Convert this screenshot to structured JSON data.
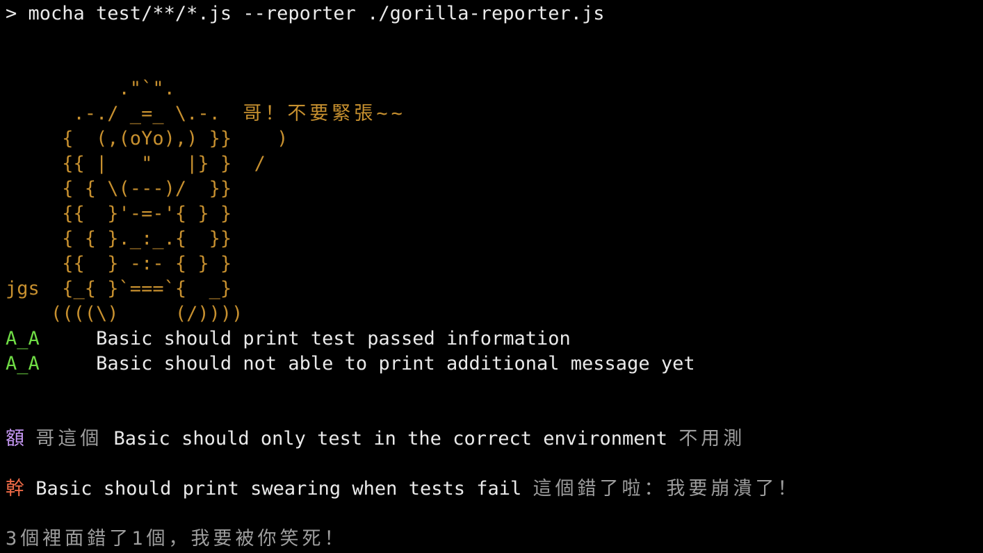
{
  "terminal": {
    "command": "> mocha test/**/*.js --reporter ./gorilla-reporter.js",
    "gorilla_art": [
      "          .\"`\".",
      "      .-./ _=_ \\.-.  ",
      "     {  (,(oYo),) }}    )",
      "     {{ |   \"   |} }  /",
      "     { { \\(---)/  }}",
      "     {{  }'-=-'{ } }",
      "     { { }._:_.{  }}",
      "     {{  } -:- { } }",
      "jgs  {_{ }`===`{  _}",
      "    ((((\\)     (/))))"
    ],
    "gorilla_speech": "哥！不要緊張~~",
    "passes": [
      {
        "marker": "A_A",
        "text": "Basic should print test passed information"
      },
      {
        "marker": "A_A",
        "text": "Basic should not able to print additional message yet"
      }
    ],
    "pending": {
      "marker": "額",
      "prefix": "哥這個",
      "text": "Basic should only test in the correct environment",
      "suffix": "不用測"
    },
    "failure": {
      "marker": "幹",
      "text": "Basic should print swearing when tests fail",
      "message": "這個錯了啦：我要崩潰了！"
    },
    "summary": "3個裡面錯了1個，我要被你笑死！"
  },
  "colors": {
    "background": "#000000",
    "art": "#c7902f",
    "pass": "#6fdc45",
    "pending": "#c99af7",
    "fail": "#ef6b47",
    "dim": "#9e9e9e",
    "text": "#eaeaea"
  }
}
